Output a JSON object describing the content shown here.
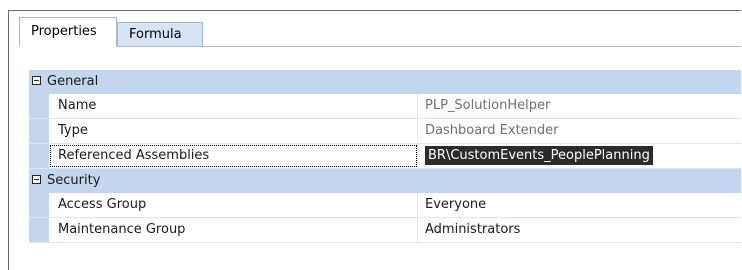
{
  "tabs": [
    {
      "label": "Properties",
      "active": true
    },
    {
      "label": "Formula",
      "active": false
    }
  ],
  "categories": [
    {
      "name": "General",
      "properties": [
        {
          "name": "Name",
          "value": "PLP_SolutionHelper",
          "readonly": true
        },
        {
          "name": "Type",
          "value": "Dashboard Extender",
          "readonly": true
        },
        {
          "name": "Referenced Assemblies",
          "value": "BR\\CustomEvents_PeoplePlanning",
          "selected": true
        }
      ]
    },
    {
      "name": "Security",
      "properties": [
        {
          "name": "Access Group",
          "value": "Everyone"
        },
        {
          "name": "Maintenance Group",
          "value": "Administrators"
        }
      ]
    }
  ],
  "colors": {
    "category_bg": "#c4d6ee",
    "inactive_tab_bg": "#d6e4f5",
    "selection_bg": "#2b2b2b"
  }
}
